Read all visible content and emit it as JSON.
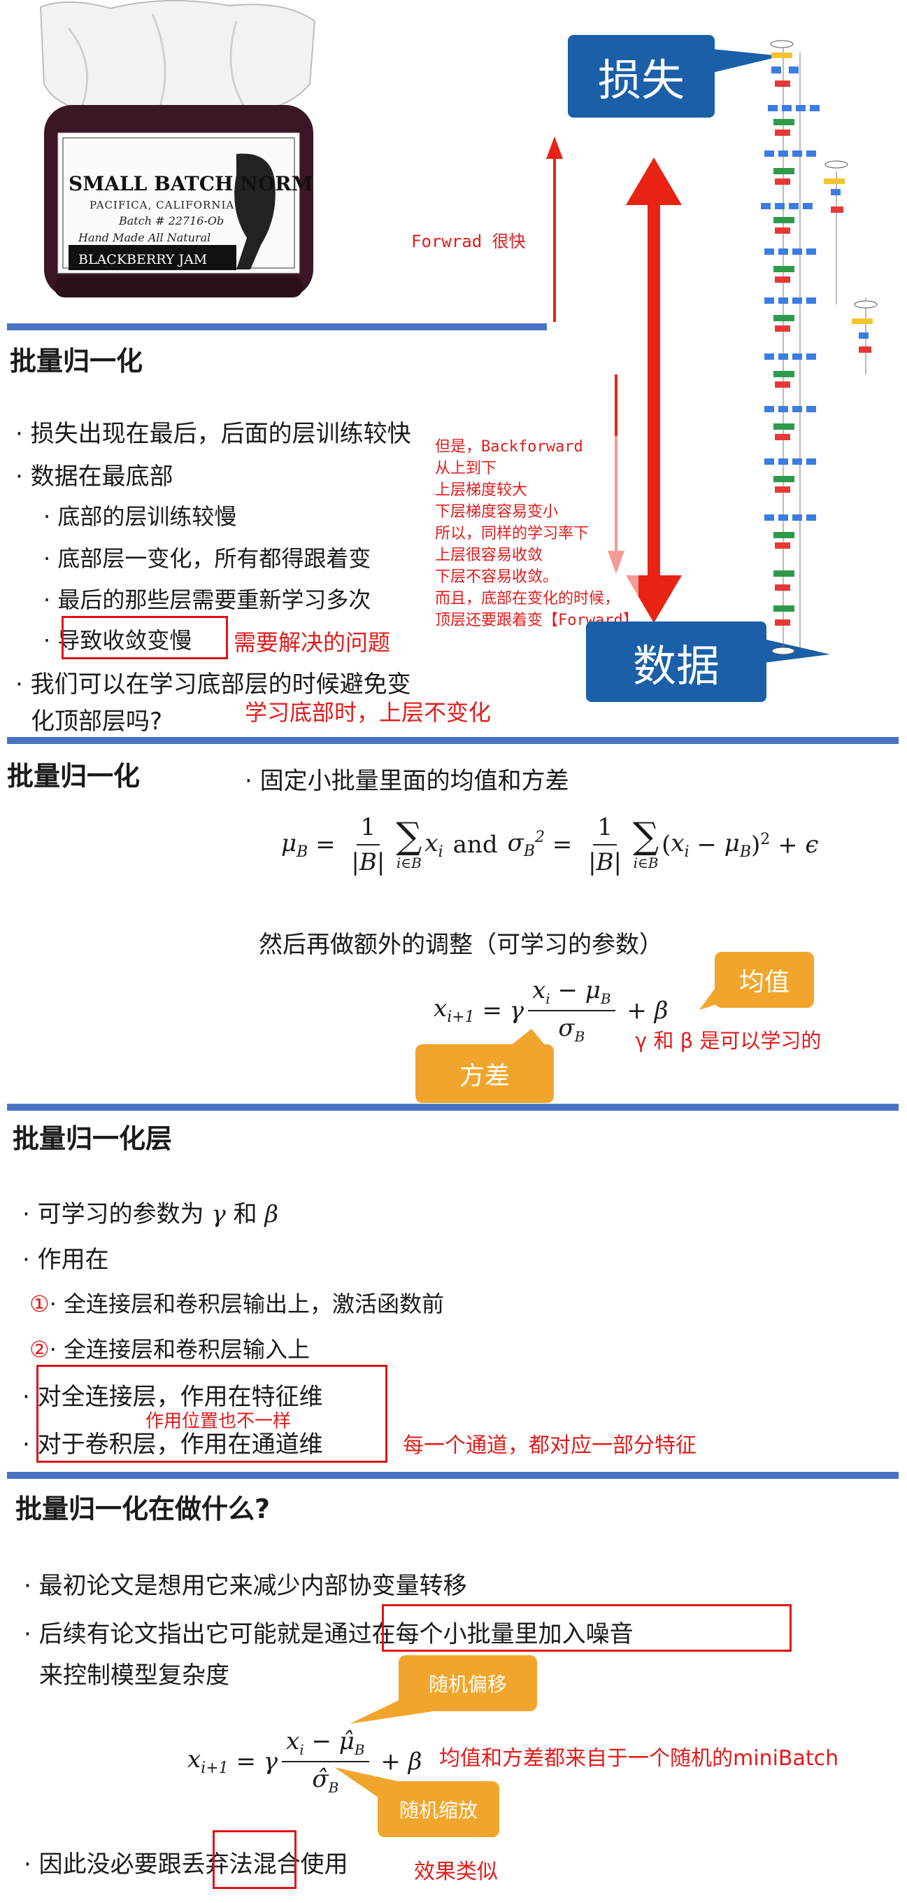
{
  "jar": {
    "lines": [
      "SMALL BATCH NORM",
      "PACIFICA, CALIFORNIA",
      "Batch # 22716-Ob",
      "Hand Made All Natural",
      "BLACKBERRY JAM"
    ]
  },
  "top_diagram": {
    "loss_label": "损失",
    "data_label": "数据",
    "forward_note": "Forwrad 很快",
    "backward_note": "但是，Backforward\n从上到下\n上层梯度较大\n下层梯度容易变小\n所以，同样的学习率下\n上层很容易收敛\n下层不容易收敛。\n而且，底部在变化的时候，\n顶层还要跟着变【Forward】"
  },
  "sec1": {
    "title": "批量归一化",
    "b1": "损失出现在最后，后面的层训练较快",
    "b2": "数据在最底部",
    "s1": "底部的层训练较慢",
    "s2": "底部层一变化，所有都得跟着变",
    "s3": "最后的那些层需要重新学习多次",
    "s4": "导致收敛变慢",
    "s4_note": "需要解决的问题",
    "b3_line1": "我们可以在学习底部层的时候避免变",
    "b3_line2": "化顶部层吗?",
    "b3_note": "学习底部时，上层不变化"
  },
  "sec2": {
    "title": "批量归一化",
    "bullet": "固定小批量里面的均值和方差",
    "and_word": "and",
    "adjust_text": "然后再做额外的调整（可学习的参数）",
    "mean_bubble": "均值",
    "var_bubble": "方差",
    "learnable_note": "γ 和 β 是可以学习的"
  },
  "sec3": {
    "title": "批量归一化层",
    "b1_text": "可学习的参数为",
    "b1_sym1": "γ",
    "b1_and": "和",
    "b1_sym2": "β",
    "b2": "作用在",
    "n1_mark": "①",
    "n1": "全连接层和卷积层输出上，激活函数前",
    "n2_mark": "②",
    "n2": "全连接层和卷积层输入上",
    "b3": "对全连接层，作用在特征维",
    "b4": "对于卷积层，作用在通道维",
    "pos_note": "作用位置也不一样",
    "channel_note": "每一个通道，都对应一部分特征"
  },
  "sec4": {
    "title": "批量归一化在做什么?",
    "b1": "最初论文是想用它来减少内部协变量转移",
    "b2_part1": "后续有论文指出它可能就是",
    "b2_part2": "通过在每个小批量里加入噪音",
    "b2_line2": "来控制模型复杂度",
    "shift_bubble": "随机偏移",
    "scale_bubble": "随机缩放",
    "minibatch_note": "均值和方差都来自于一个随机的miniBatch",
    "b3_part1": "因此没必要跟",
    "b3_part2": "丢弃法",
    "b3_part3": "混合使用",
    "b3_note": "效果类似"
  },
  "colors": {
    "divider": "#4a72c4",
    "annotation_red": "#e21b1b",
    "bubble_blue": "#1a5fa8",
    "bubble_orange": "#f2a52c"
  }
}
